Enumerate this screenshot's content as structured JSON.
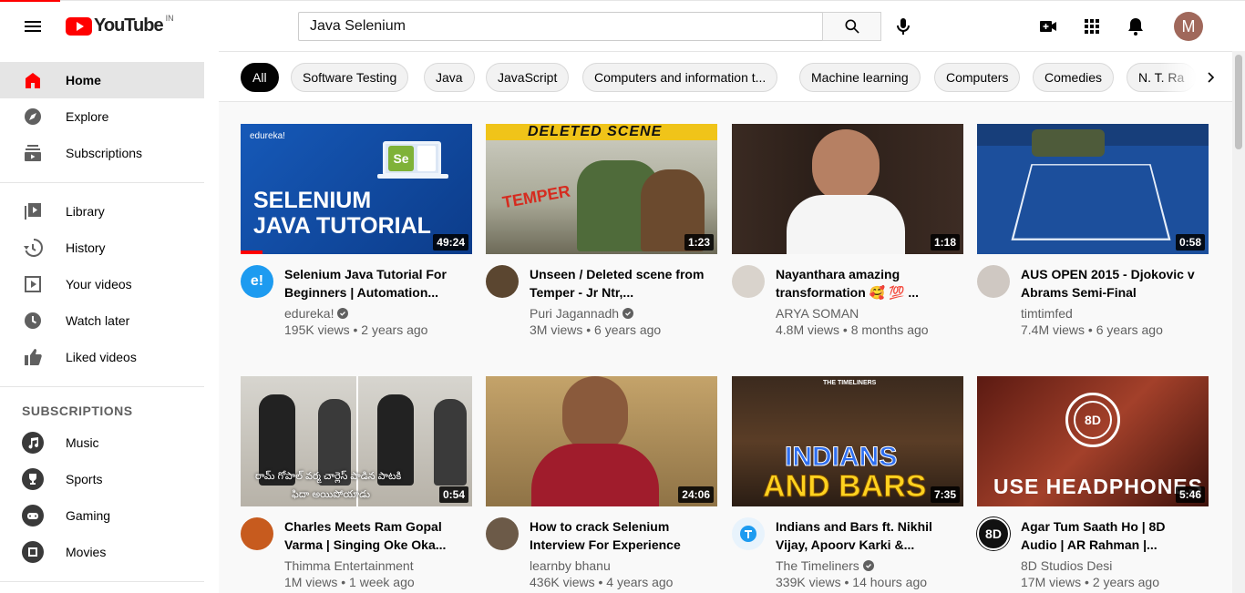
{
  "header": {
    "logo_text": "YouTube",
    "country_code": "IN",
    "search_value": "Java Selenium",
    "avatar_letter": "M",
    "icons": [
      "menu-icon",
      "search-icon",
      "mic-icon",
      "create-video-icon",
      "apps-grid-icon",
      "notifications-bell-icon"
    ]
  },
  "sidebar": {
    "main": [
      {
        "label": "Home",
        "icon": "home-icon",
        "active": true
      },
      {
        "label": "Explore",
        "icon": "explore-icon"
      },
      {
        "label": "Subscriptions",
        "icon": "subscriptions-icon"
      }
    ],
    "library": [
      {
        "label": "Library",
        "icon": "library-icon"
      },
      {
        "label": "History",
        "icon": "history-icon"
      },
      {
        "label": "Your videos",
        "icon": "your-videos-icon"
      },
      {
        "label": "Watch later",
        "icon": "watch-later-icon"
      },
      {
        "label": "Liked videos",
        "icon": "liked-videos-icon"
      }
    ],
    "subscriptions_heading": "SUBSCRIPTIONS",
    "subscriptions": [
      {
        "label": "Music",
        "icon": "music-icon"
      },
      {
        "label": "Sports",
        "icon": "sports-icon"
      },
      {
        "label": "Gaming",
        "icon": "gaming-icon"
      },
      {
        "label": "Movies",
        "icon": "movies-icon"
      }
    ]
  },
  "chips": [
    "All",
    "Software Testing",
    "Java",
    "JavaScript",
    "Computers and information t...",
    "Machine learning",
    "Computers",
    "Comedies",
    "N. T. Ra"
  ],
  "videos": [
    {
      "title": "Selenium Java Tutorial For Beginners | Automation...",
      "channel": "edureka!",
      "verified": true,
      "views": "195K views",
      "age": "2 years ago",
      "duration": "49:24",
      "thumb_text_1": "SELENIUM",
      "thumb_text_2": "JAVA TUTORIAL",
      "brand": "edureka!",
      "avatar_text": "e!"
    },
    {
      "title": "Unseen / Deleted scene from Temper - Jr Ntr,...",
      "channel": "Puri Jagannadh",
      "verified": true,
      "views": "3M views",
      "age": "6 years ago",
      "duration": "1:23",
      "thumb_text_1": "DELETED SCENE",
      "thumb_text_2": "TEMPER"
    },
    {
      "title": "Nayanthara amazing transformation 🥰 💯 ...",
      "channel": "ARYA SOMAN",
      "verified": false,
      "views": "4.8M views",
      "age": "8 months ago",
      "duration": "1:18"
    },
    {
      "title": "AUS OPEN 2015 - Djokovic v Abrams Semi-Final",
      "channel": "timtimfed",
      "verified": false,
      "views": "7.4M views",
      "age": "6 years ago",
      "duration": "0:58"
    },
    {
      "title": "Charles Meets Ram Gopal Varma | Singing Oke Oka...",
      "channel": "Thimma Entertainment",
      "verified": false,
      "views": "1M views",
      "age": "1 week ago",
      "duration": "0:54",
      "thumb_text_1": "రామ్ గోపాల్ వర్మ చార్లెస్ పాడిన పాటకి",
      "thumb_text_2": "ఫిదా అయిపోయాడు"
    },
    {
      "title": "How to crack Selenium Interview For Experience",
      "channel": "learnby bhanu",
      "verified": false,
      "views": "436K views",
      "age": "4 years ago",
      "duration": "24:06"
    },
    {
      "title": "Indians and Bars ft. Nikhil Vijay, Apoorv Karki &...",
      "channel": "The Timeliners",
      "verified": true,
      "views": "339K views",
      "age": "14 hours ago",
      "duration": "7:35",
      "thumb_text_1": "INDIANS",
      "thumb_text_2": "AND BARS",
      "brand": "THE TIMELINERS"
    },
    {
      "title": "Agar Tum Saath Ho | 8D Audio | AR Rahman |...",
      "channel": "8D Studios Desi",
      "verified": false,
      "views": "17M views",
      "age": "2 years ago",
      "duration": "5:46",
      "thumb_text_1": "USE HEADPHONES",
      "thumb_text_2": "8D",
      "avatar_text": "8D"
    }
  ],
  "colors": {
    "accent": "#ff0000",
    "chip_active": "#030303",
    "meta_text": "#606060"
  }
}
